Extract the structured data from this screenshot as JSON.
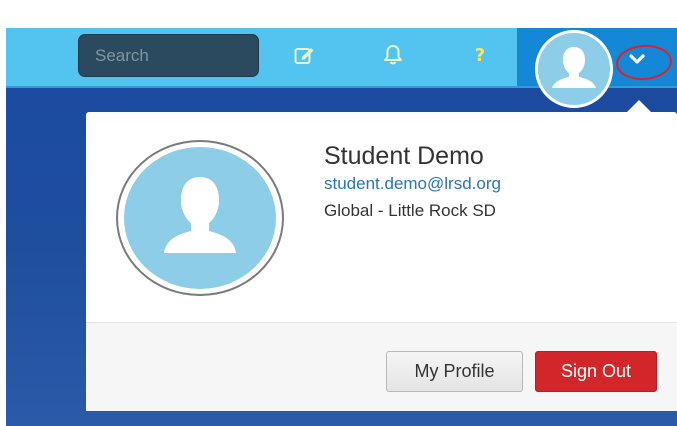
{
  "colors": {
    "topbar": "#53c4ef",
    "user_button": "#1487d6",
    "background": "#1f4e9f",
    "avatar": "#8ecde8",
    "sign_out": "#d3262b",
    "link": "#2a73b8",
    "annotation": "#d8232a"
  },
  "topbar": {
    "search": {
      "placeholder": "Search"
    },
    "icons": {
      "edit": "edit-icon",
      "notifications": "bell-icon",
      "help": "?"
    },
    "user_menu": {
      "avatar": "user-avatar-icon",
      "toggle": "chevron-down-icon"
    }
  },
  "profile_panel": {
    "name": "Student Demo",
    "email": "student.demo@lrsd.org",
    "organization": "Global - Little Rock SD",
    "buttons": {
      "my_profile": "My Profile",
      "sign_out": "Sign Out"
    }
  }
}
